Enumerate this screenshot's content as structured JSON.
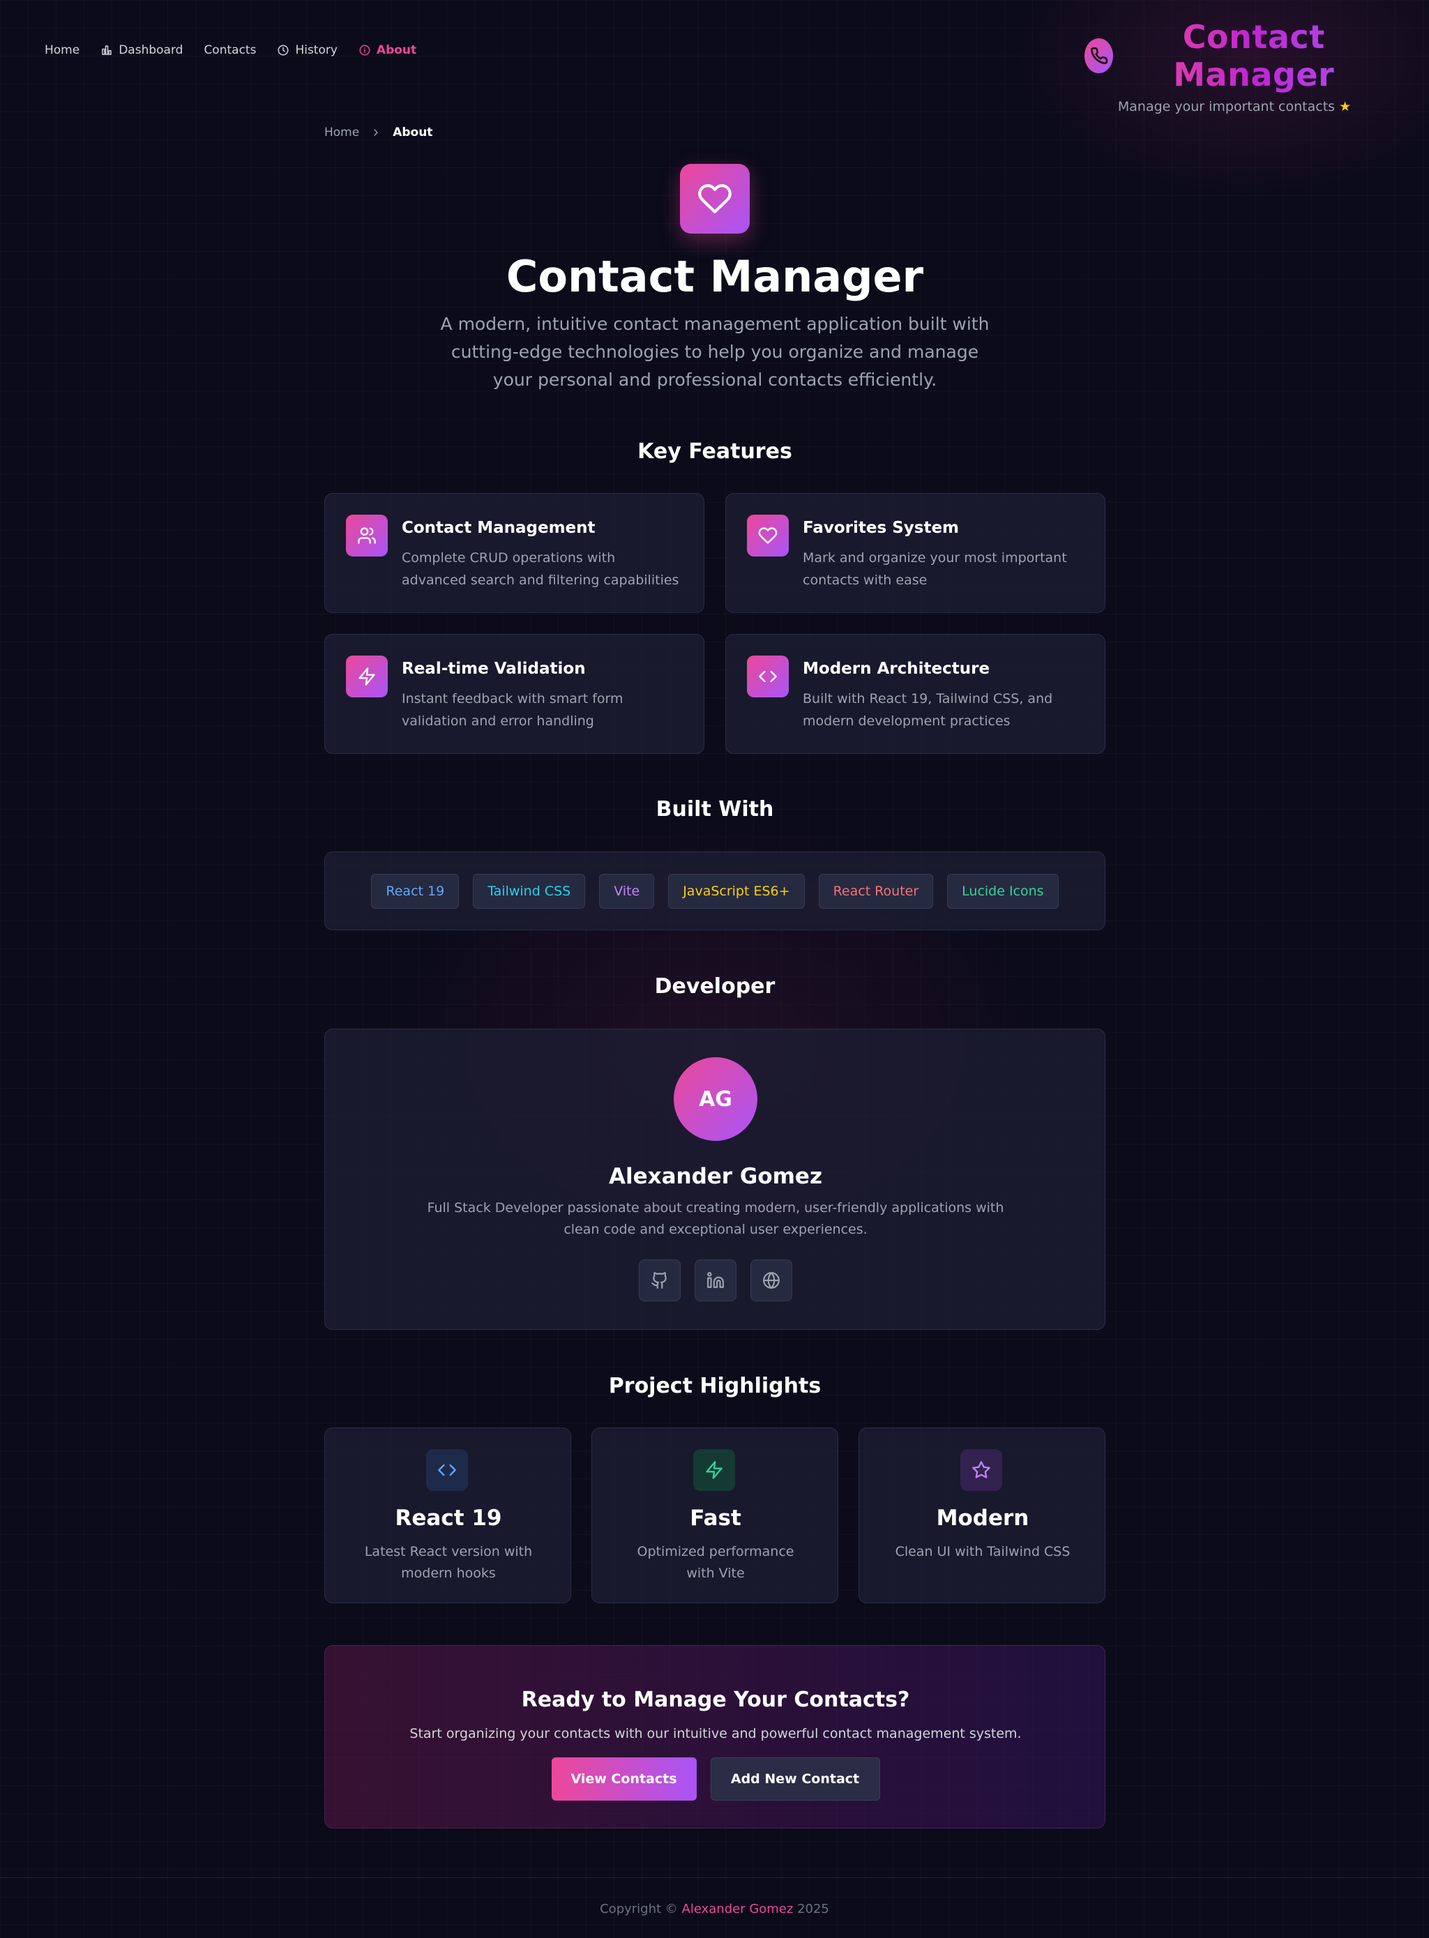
{
  "nav": {
    "items": [
      {
        "label": "Home",
        "icon": "none"
      },
      {
        "label": "Dashboard",
        "icon": "bar-chart-icon"
      },
      {
        "label": "Contacts",
        "icon": "none"
      },
      {
        "label": "History",
        "icon": "clock-icon"
      },
      {
        "label": "About",
        "icon": "info-icon",
        "active": true
      }
    ]
  },
  "brand": {
    "title": "Contact Manager",
    "subtitle": "Manage your important contacts",
    "star": "★",
    "icon": "phone-icon"
  },
  "breadcrumb": {
    "home": "Home",
    "current": "About"
  },
  "hero": {
    "icon": "heart-icon",
    "title": "Contact Manager",
    "description": "A modern, intuitive contact management application built with cutting-edge technologies to help you organize and manage your personal and professional contacts efficiently."
  },
  "features": {
    "title": "Key Features",
    "items": [
      {
        "title": "Contact Management",
        "desc": "Complete CRUD operations with advanced search and filtering capabilities",
        "icon": "users-icon"
      },
      {
        "title": "Favorites System",
        "desc": "Mark and organize your most important contacts with ease",
        "icon": "heart-icon"
      },
      {
        "title": "Real-time Validation",
        "desc": "Instant feedback with smart form validation and error handling",
        "icon": "zap-icon"
      },
      {
        "title": "Modern Architecture",
        "desc": "Built with React 19, Tailwind CSS, and modern development practices",
        "icon": "code-icon"
      }
    ]
  },
  "built_with": {
    "title": "Built With",
    "items": [
      {
        "label": "React 19",
        "color": "#60a5fa"
      },
      {
        "label": "Tailwind CSS",
        "color": "#22d3ee"
      },
      {
        "label": "Vite",
        "color": "#c084fc"
      },
      {
        "label": "JavaScript ES6+",
        "color": "#facc15"
      },
      {
        "label": "React Router",
        "color": "#f87171"
      },
      {
        "label": "Lucide Icons",
        "color": "#34d399"
      }
    ]
  },
  "developer": {
    "title": "Developer",
    "initials": "AG",
    "name": "Alexander Gomez",
    "bio": "Full Stack Developer passionate about creating modern, user-friendly applications with clean code and exceptional user experiences.",
    "socials": [
      "github-icon",
      "linkedin-icon",
      "globe-icon"
    ]
  },
  "highlights": {
    "title": "Project Highlights",
    "items": [
      {
        "title": "React 19",
        "desc": "Latest React version with modern hooks",
        "icon": "code-icon",
        "color": "#60a5fa",
        "bg": "#1e2a4a"
      },
      {
        "title": "Fast",
        "desc": "Optimized performance with Vite",
        "icon": "zap-icon",
        "color": "#34d399",
        "bg": "#143a33"
      },
      {
        "title": "Modern",
        "desc": "Clean UI with Tailwind CSS",
        "icon": "star-icon",
        "color": "#c084fc",
        "bg": "#33214f"
      }
    ]
  },
  "cta": {
    "title": "Ready to Manage Your Contacts?",
    "description": "Start organizing your contacts with our intuitive and powerful contact management system.",
    "primary": "View Contacts",
    "secondary": "Add New Contact"
  },
  "footer": {
    "prefix": "Copyright ©",
    "author": "Alexander Gomez",
    "year": "2025"
  },
  "colors": {
    "accent": "#ec4899",
    "accent_secondary": "#a855f7",
    "background": "#0b0b1a"
  }
}
